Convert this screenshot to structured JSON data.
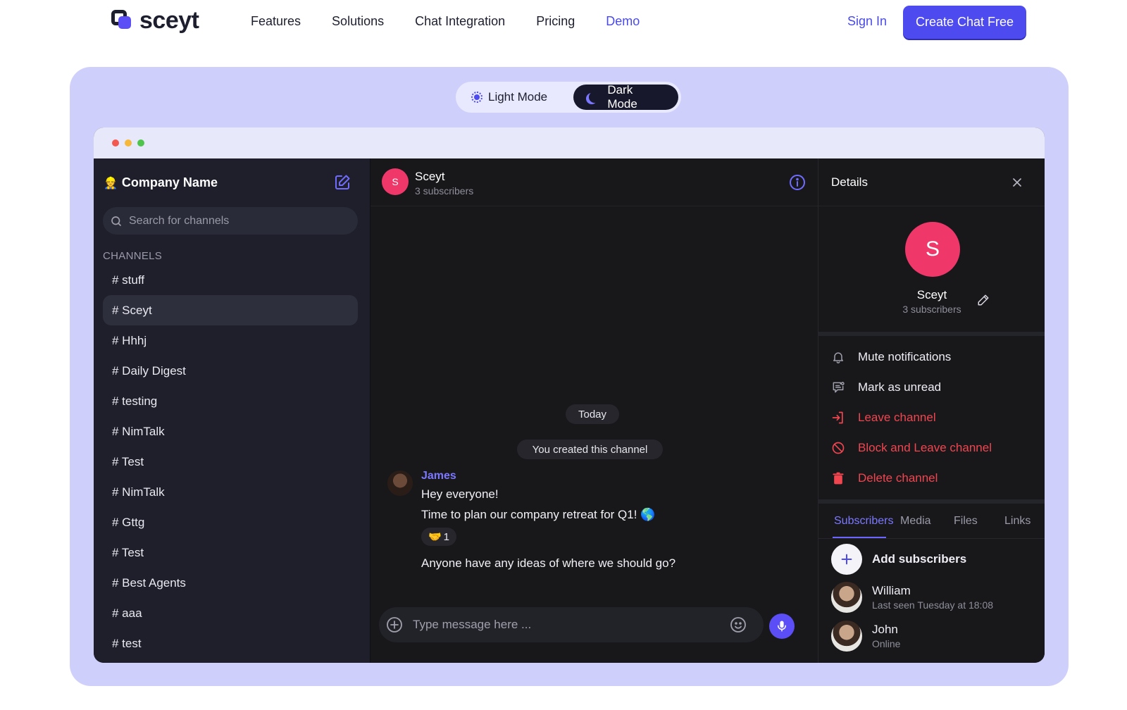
{
  "nav": {
    "brand": "sceyt",
    "links": [
      "Features",
      "Solutions",
      "Chat Integration",
      "Pricing",
      "Demo"
    ],
    "active_link": "Demo",
    "sign_in": "Sign In",
    "cta": "Create Chat Free"
  },
  "mode_toggle": {
    "light_label": "Light Mode",
    "dark_label": "Dark Mode",
    "selected": "Dark Mode"
  },
  "sidebar": {
    "company": "Company Name",
    "search_placeholder": "Search for channels",
    "section": "CHANNELS",
    "channels": [
      "# stuff",
      "# Sceyt",
      "# Hhhj",
      "# Daily Digest",
      "# testing",
      "# NimTalk",
      "# Test",
      "# NimTalk",
      "# Gttg",
      "# Test",
      "# Best Agents",
      "# aaa",
      "# test"
    ],
    "selected_channel": "# Sceyt"
  },
  "chat": {
    "avatar_letter": "S",
    "title": "Sceyt",
    "subtitle": "3 subscribers",
    "date_pill": "Today",
    "system_msg": "You created this channel",
    "sender": "James",
    "messages": [
      "Hey everyone!",
      "Time to plan our company retreat for Q1! 🌎",
      "Anyone have any ideas of where we should go?"
    ],
    "reaction": {
      "emoji": "🤝",
      "count": "1"
    },
    "composer_placeholder": "Type message here ..."
  },
  "details": {
    "title": "Details",
    "avatar_letter": "S",
    "name": "Sceyt",
    "subtitle": "3 subscribers",
    "actions": {
      "mute": "Mute notifications",
      "unread": "Mark as unread",
      "leave": "Leave channel",
      "block": "Block and Leave channel",
      "delete": "Delete channel"
    },
    "tabs": [
      "Subscribers",
      "Media",
      "Files",
      "Links"
    ],
    "active_tab": "Subscribers",
    "add_subscribers": "Add subscribers",
    "members": [
      {
        "name": "William",
        "status": "Last seen Tuesday at 18:08"
      },
      {
        "name": "John",
        "status": "Online"
      }
    ]
  },
  "colors": {
    "accent": "#4d4af0",
    "hero_bg": "#cfcffc",
    "danger": "#f1454f",
    "avatar": "#f0376a"
  }
}
